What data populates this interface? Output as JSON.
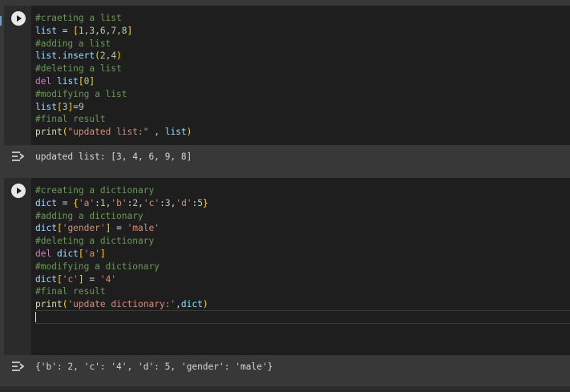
{
  "cells": [
    {
      "lines": [
        [
          {
            "t": "#craeting a list",
            "c": "comment"
          }
        ],
        [
          {
            "t": "list",
            "c": "name"
          },
          {
            "t": " = ",
            "c": "op"
          },
          {
            "t": "[",
            "c": "br1"
          },
          {
            "t": "1,3,6,7,8",
            "c": "num"
          },
          {
            "t": "]",
            "c": "br1"
          }
        ],
        [
          {
            "t": "#adding a list",
            "c": "comment"
          }
        ],
        [
          {
            "t": "list",
            "c": "name"
          },
          {
            "t": ".",
            "c": "op"
          },
          {
            "t": "insert",
            "c": "name"
          },
          {
            "t": "(",
            "c": "br1"
          },
          {
            "t": "2,4",
            "c": "num"
          },
          {
            "t": ")",
            "c": "br1"
          }
        ],
        [
          {
            "t": "#deleting a list",
            "c": "comment"
          }
        ],
        [
          {
            "t": "del",
            "c": "kw"
          },
          {
            "t": " ",
            "c": "op"
          },
          {
            "t": "list",
            "c": "name"
          },
          {
            "t": "[",
            "c": "br1"
          },
          {
            "t": "0",
            "c": "num"
          },
          {
            "t": "]",
            "c": "br1"
          }
        ],
        [
          {
            "t": "#modifying a list",
            "c": "comment"
          }
        ],
        [
          {
            "t": "list",
            "c": "name"
          },
          {
            "t": "[",
            "c": "br1"
          },
          {
            "t": "3",
            "c": "num"
          },
          {
            "t": "]",
            "c": "br1"
          },
          {
            "t": "=",
            "c": "op"
          },
          {
            "t": "9",
            "c": "num"
          }
        ],
        [
          {
            "t": "#final result",
            "c": "comment"
          }
        ],
        [
          {
            "t": "print",
            "c": "func"
          },
          {
            "t": "(",
            "c": "br1"
          },
          {
            "t": "\"updated list:\"",
            "c": "str"
          },
          {
            "t": " , ",
            "c": "op"
          },
          {
            "t": "list",
            "c": "name"
          },
          {
            "t": ")",
            "c": "br1"
          }
        ]
      ],
      "output": "updated list: [3, 4, 6, 9, 8]"
    },
    {
      "lines": [
        [
          {
            "t": "#creating a dictionary",
            "c": "comment"
          }
        ],
        [
          {
            "t": "dict",
            "c": "name"
          },
          {
            "t": " = ",
            "c": "op"
          },
          {
            "t": "{",
            "c": "br1"
          },
          {
            "t": "'a'",
            "c": "str"
          },
          {
            "t": ":",
            "c": "op"
          },
          {
            "t": "1",
            "c": "num"
          },
          {
            "t": ",",
            "c": "op"
          },
          {
            "t": "'b'",
            "c": "str"
          },
          {
            "t": ":",
            "c": "op"
          },
          {
            "t": "2",
            "c": "num"
          },
          {
            "t": ",",
            "c": "op"
          },
          {
            "t": "'c'",
            "c": "str"
          },
          {
            "t": ":",
            "c": "op"
          },
          {
            "t": "3",
            "c": "num"
          },
          {
            "t": ",",
            "c": "op"
          },
          {
            "t": "'d'",
            "c": "str"
          },
          {
            "t": ":",
            "c": "op"
          },
          {
            "t": "5",
            "c": "num"
          },
          {
            "t": "}",
            "c": "br1"
          }
        ],
        [
          {
            "t": "#adding a dictionary",
            "c": "comment"
          }
        ],
        [
          {
            "t": "dict",
            "c": "name"
          },
          {
            "t": "[",
            "c": "br1"
          },
          {
            "t": "'gender'",
            "c": "str"
          },
          {
            "t": "]",
            "c": "br1"
          },
          {
            "t": " = ",
            "c": "op"
          },
          {
            "t": "'male'",
            "c": "str"
          }
        ],
        [
          {
            "t": "#deleting a dictionary",
            "c": "comment"
          }
        ],
        [
          {
            "t": "del",
            "c": "kw"
          },
          {
            "t": " ",
            "c": "op"
          },
          {
            "t": "dict",
            "c": "name"
          },
          {
            "t": "[",
            "c": "br1"
          },
          {
            "t": "'a'",
            "c": "str"
          },
          {
            "t": "]",
            "c": "br1"
          }
        ],
        [
          {
            "t": "#modifying a dictionary",
            "c": "comment"
          }
        ],
        [
          {
            "t": "dict",
            "c": "name"
          },
          {
            "t": "[",
            "c": "br1"
          },
          {
            "t": "'c'",
            "c": "str"
          },
          {
            "t": "]",
            "c": "br1"
          },
          {
            "t": " = ",
            "c": "op"
          },
          {
            "t": "'4'",
            "c": "str"
          }
        ],
        [
          {
            "t": "#final result",
            "c": "comment"
          }
        ],
        [
          {
            "t": "print",
            "c": "func"
          },
          {
            "t": "(",
            "c": "br1"
          },
          {
            "t": "'update dictionary:'",
            "c": "str"
          },
          {
            "t": ",",
            "c": "op"
          },
          {
            "t": "dict",
            "c": "name"
          },
          {
            "t": ")",
            "c": "br1"
          }
        ]
      ],
      "output": "{'b': 2, 'c': '4', 'd': 5, 'gender': 'male'}"
    }
  ],
  "icons": {
    "run": "play-icon",
    "output": "output-toggle-icon"
  }
}
